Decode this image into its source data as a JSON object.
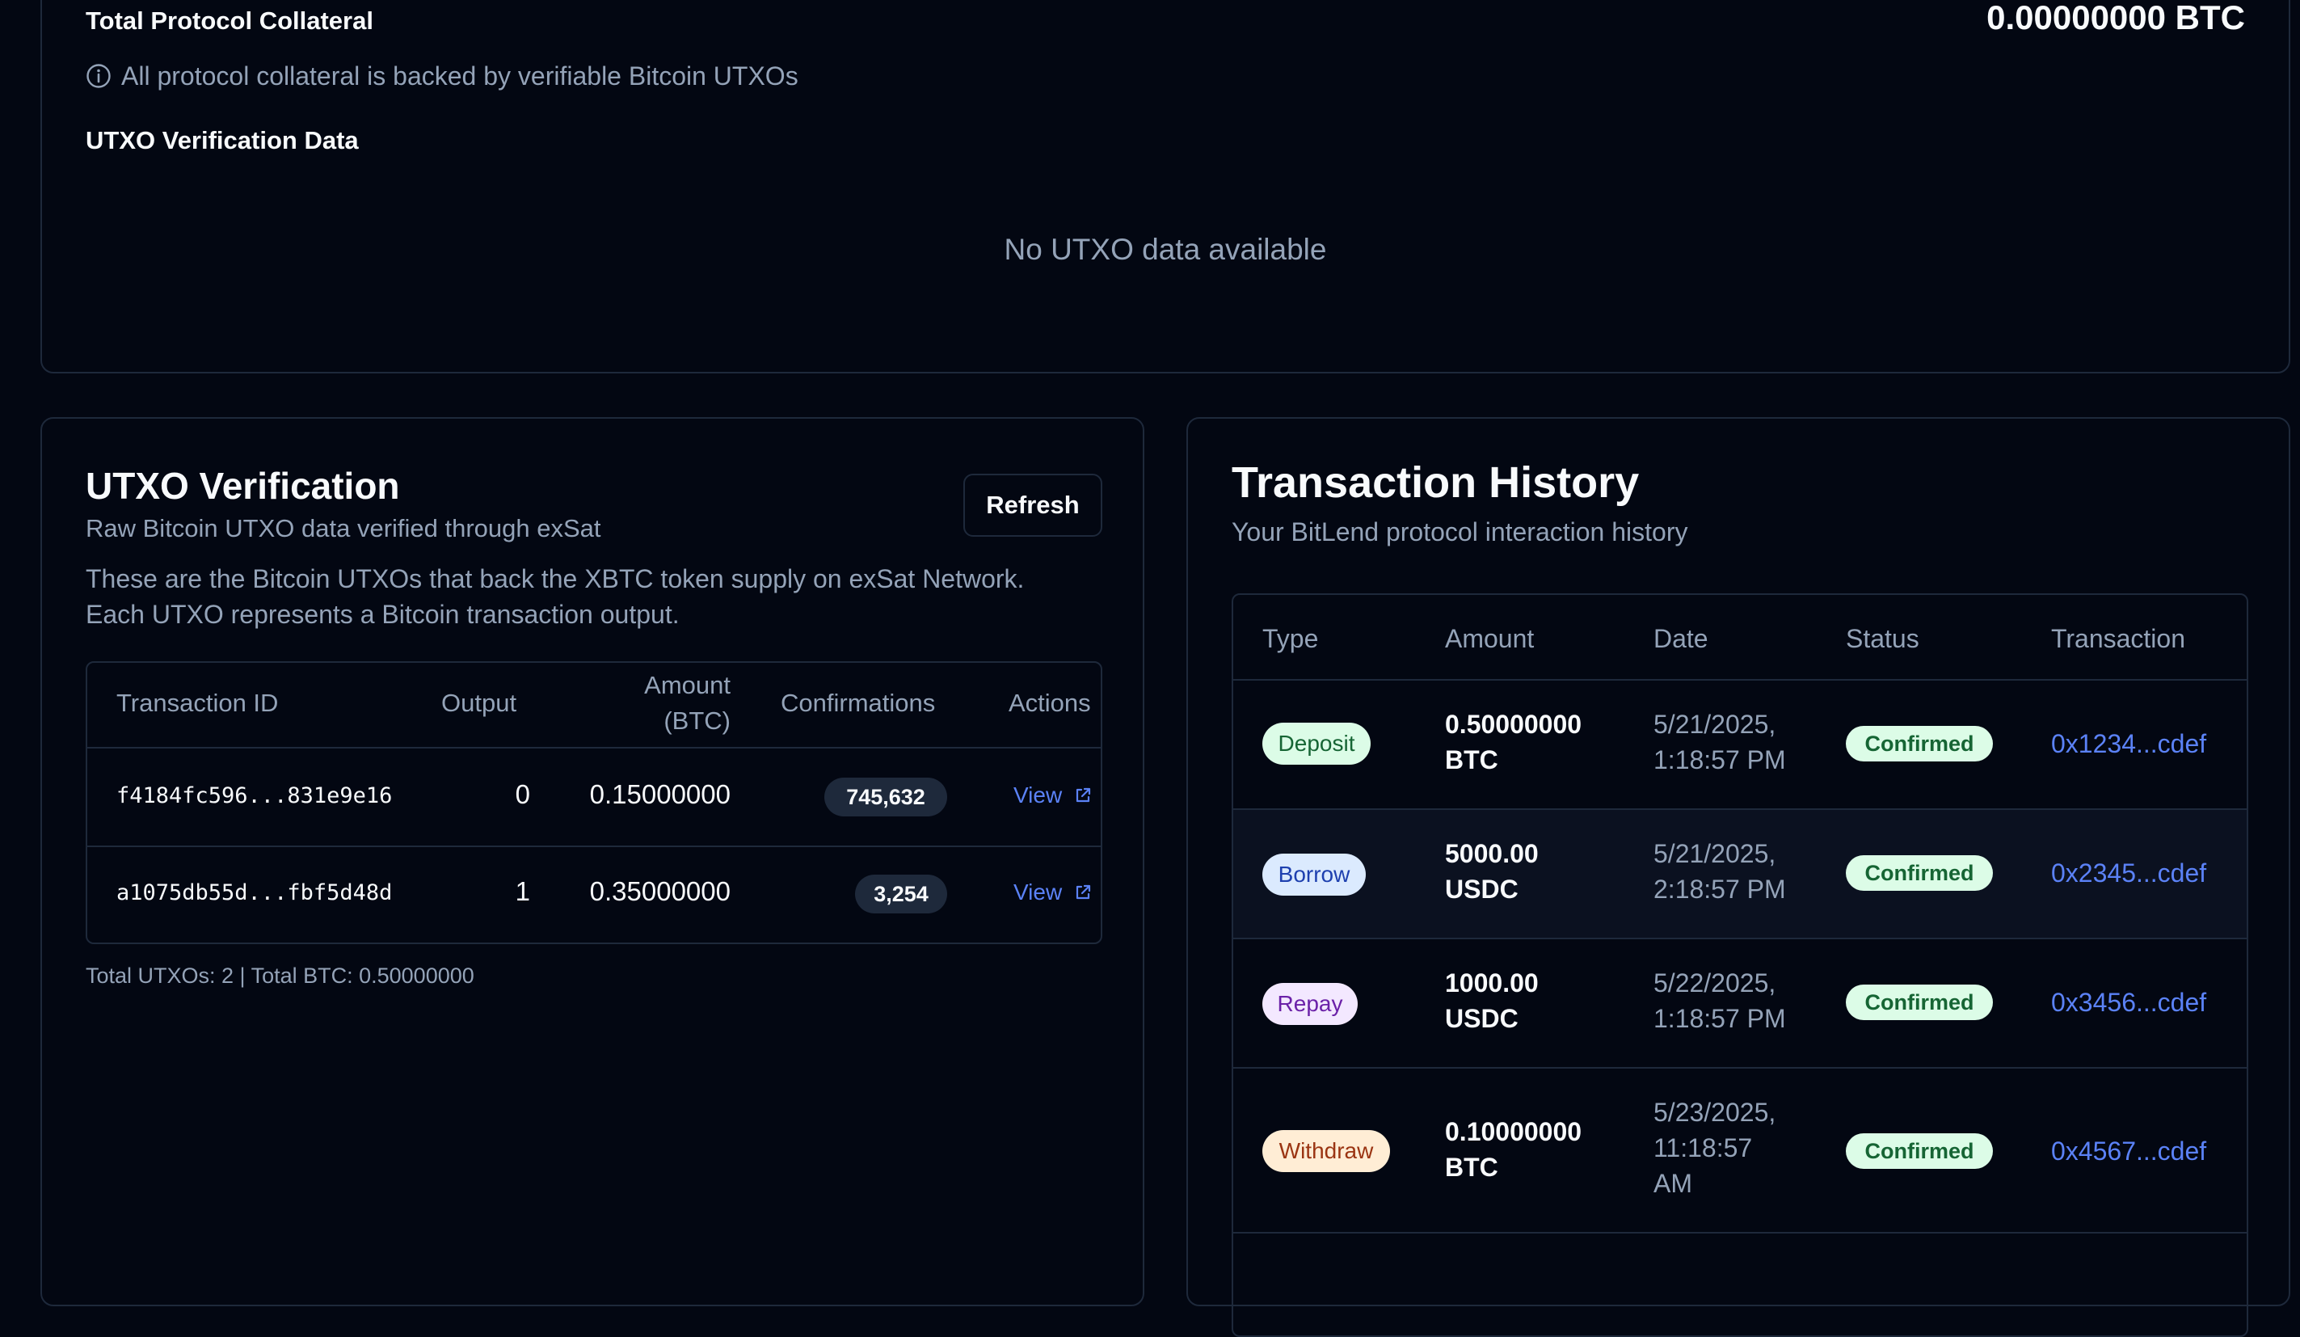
{
  "collateral": {
    "title": "Total Protocol Collateral",
    "value": "0.00000000 BTC",
    "note": "All protocol collateral is backed by verifiable Bitcoin UTXOs",
    "utxo_heading": "UTXO Verification Data",
    "empty_text": "No UTXO data available"
  },
  "utxo": {
    "title": "UTXO Verification",
    "subtitle": "Raw Bitcoin UTXO data verified through exSat",
    "refresh_label": "Refresh",
    "desc_line1": "These are the Bitcoin UTXOs that back the XBTC token supply on exSat Network.",
    "desc_line2": "Each UTXO represents a Bitcoin transaction output.",
    "headers": {
      "txid": "Transaction ID",
      "output": "Output",
      "amount_l1": "Amount",
      "amount_l2": "(BTC)",
      "confirmations": "Confirmations",
      "actions": "Actions"
    },
    "rows": [
      {
        "txid": "f4184fc596...831e9e16",
        "output": "0",
        "amount": "0.15000000",
        "confirmations": "745,632",
        "action": "View"
      },
      {
        "txid": "a1075db55d...fbf5d48d",
        "output": "1",
        "amount": "0.35000000",
        "confirmations": "3,254",
        "action": "View"
      }
    ],
    "footer": "Total UTXOs: 2 | Total BTC: 0.50000000"
  },
  "history": {
    "title": "Transaction History",
    "subtitle": "Your BitLend protocol interaction history",
    "headers": {
      "type": "Type",
      "amount": "Amount",
      "date": "Date",
      "status": "Status",
      "transaction": "Transaction"
    },
    "rows": [
      {
        "type": "Deposit",
        "amount_l1": "0.50000000",
        "amount_l2": "BTC",
        "date_l1": "5/21/2025,",
        "date_l2": "1:18:57 PM",
        "date_l3": "",
        "status": "Confirmed",
        "tx": "0x1234...cdef"
      },
      {
        "type": "Borrow",
        "amount_l1": "5000.00",
        "amount_l2": "USDC",
        "date_l1": "5/21/2025,",
        "date_l2": "2:18:57 PM",
        "date_l3": "",
        "status": "Confirmed",
        "tx": "0x2345...cdef"
      },
      {
        "type": "Repay",
        "amount_l1": "1000.00",
        "amount_l2": "USDC",
        "date_l1": "5/22/2025,",
        "date_l2": "1:18:57 PM",
        "date_l3": "",
        "status": "Confirmed",
        "tx": "0x3456...cdef"
      },
      {
        "type": "Withdraw",
        "amount_l1": "0.10000000",
        "amount_l2": "BTC",
        "date_l1": "5/23/2025,",
        "date_l2": "11:18:57",
        "date_l3": "AM",
        "status": "Confirmed",
        "tx": "0x4567...cdef"
      }
    ]
  },
  "colors": {
    "background": "#030712",
    "border": "#1e293b",
    "link": "#5b82f7",
    "status_bg": "#dcfce7",
    "status_text": "#166534"
  }
}
